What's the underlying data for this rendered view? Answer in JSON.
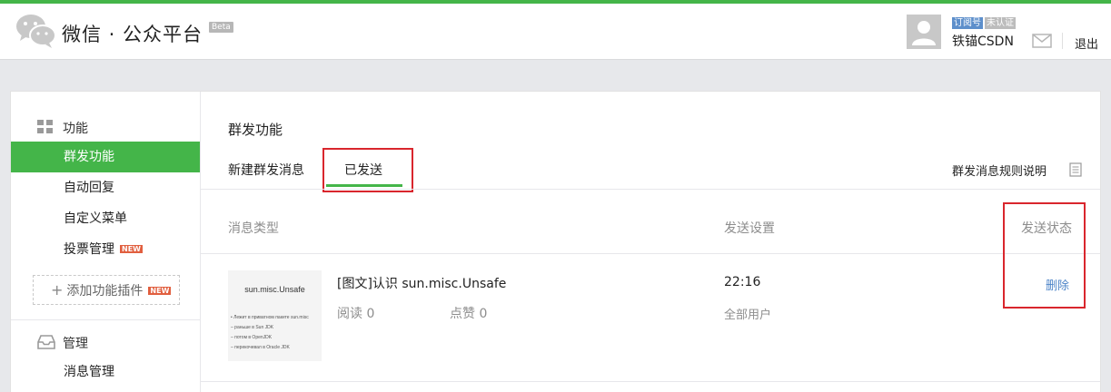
{
  "header": {
    "brand": "微信 · 公众平台",
    "beta": "Beta",
    "account_type": "订阅号",
    "verification": "未认证",
    "username": "铁锚CSDN",
    "logout": "退出"
  },
  "sidebar": {
    "section_function": "功能",
    "function_items": [
      {
        "label": "群发功能",
        "active": true
      },
      {
        "label": "自动回复"
      },
      {
        "label": "自定义菜单"
      },
      {
        "label": "投票管理",
        "new": "NEW"
      }
    ],
    "add_plugin": "添加功能插件",
    "add_plugin_new": "NEW",
    "section_manage": "管理",
    "manage_items": [
      {
        "label": "消息管理"
      }
    ]
  },
  "main": {
    "title": "群发功能",
    "tabs": [
      {
        "label": "新建群发消息"
      },
      {
        "label": "已发送",
        "active": true
      }
    ],
    "rules_link": "群发消息规则说明",
    "columns": [
      "消息类型",
      "发送设置",
      "发送状态"
    ],
    "messages": [
      {
        "title": "[图文]认识 sun.misc.Unsafe",
        "read_label": "阅读 0",
        "like_label": "点赞 0",
        "send_time": "22:16",
        "target": "全部用户",
        "action": "删除",
        "thumbnail": {
          "title": "sun.misc.Unsafe",
          "lines": [
            "• Лежит в приватном пакете sun.misc",
            "  – раньше в Sun JDK",
            "  – потом в OpenJDK",
            "  – перекочевал в Oracle JDK"
          ]
        }
      }
    ]
  },
  "colors": {
    "accent_green": "#44b549",
    "link_blue": "#4e85c8",
    "highlight_red": "#d9262d",
    "new_badge": "#e15f3f"
  }
}
